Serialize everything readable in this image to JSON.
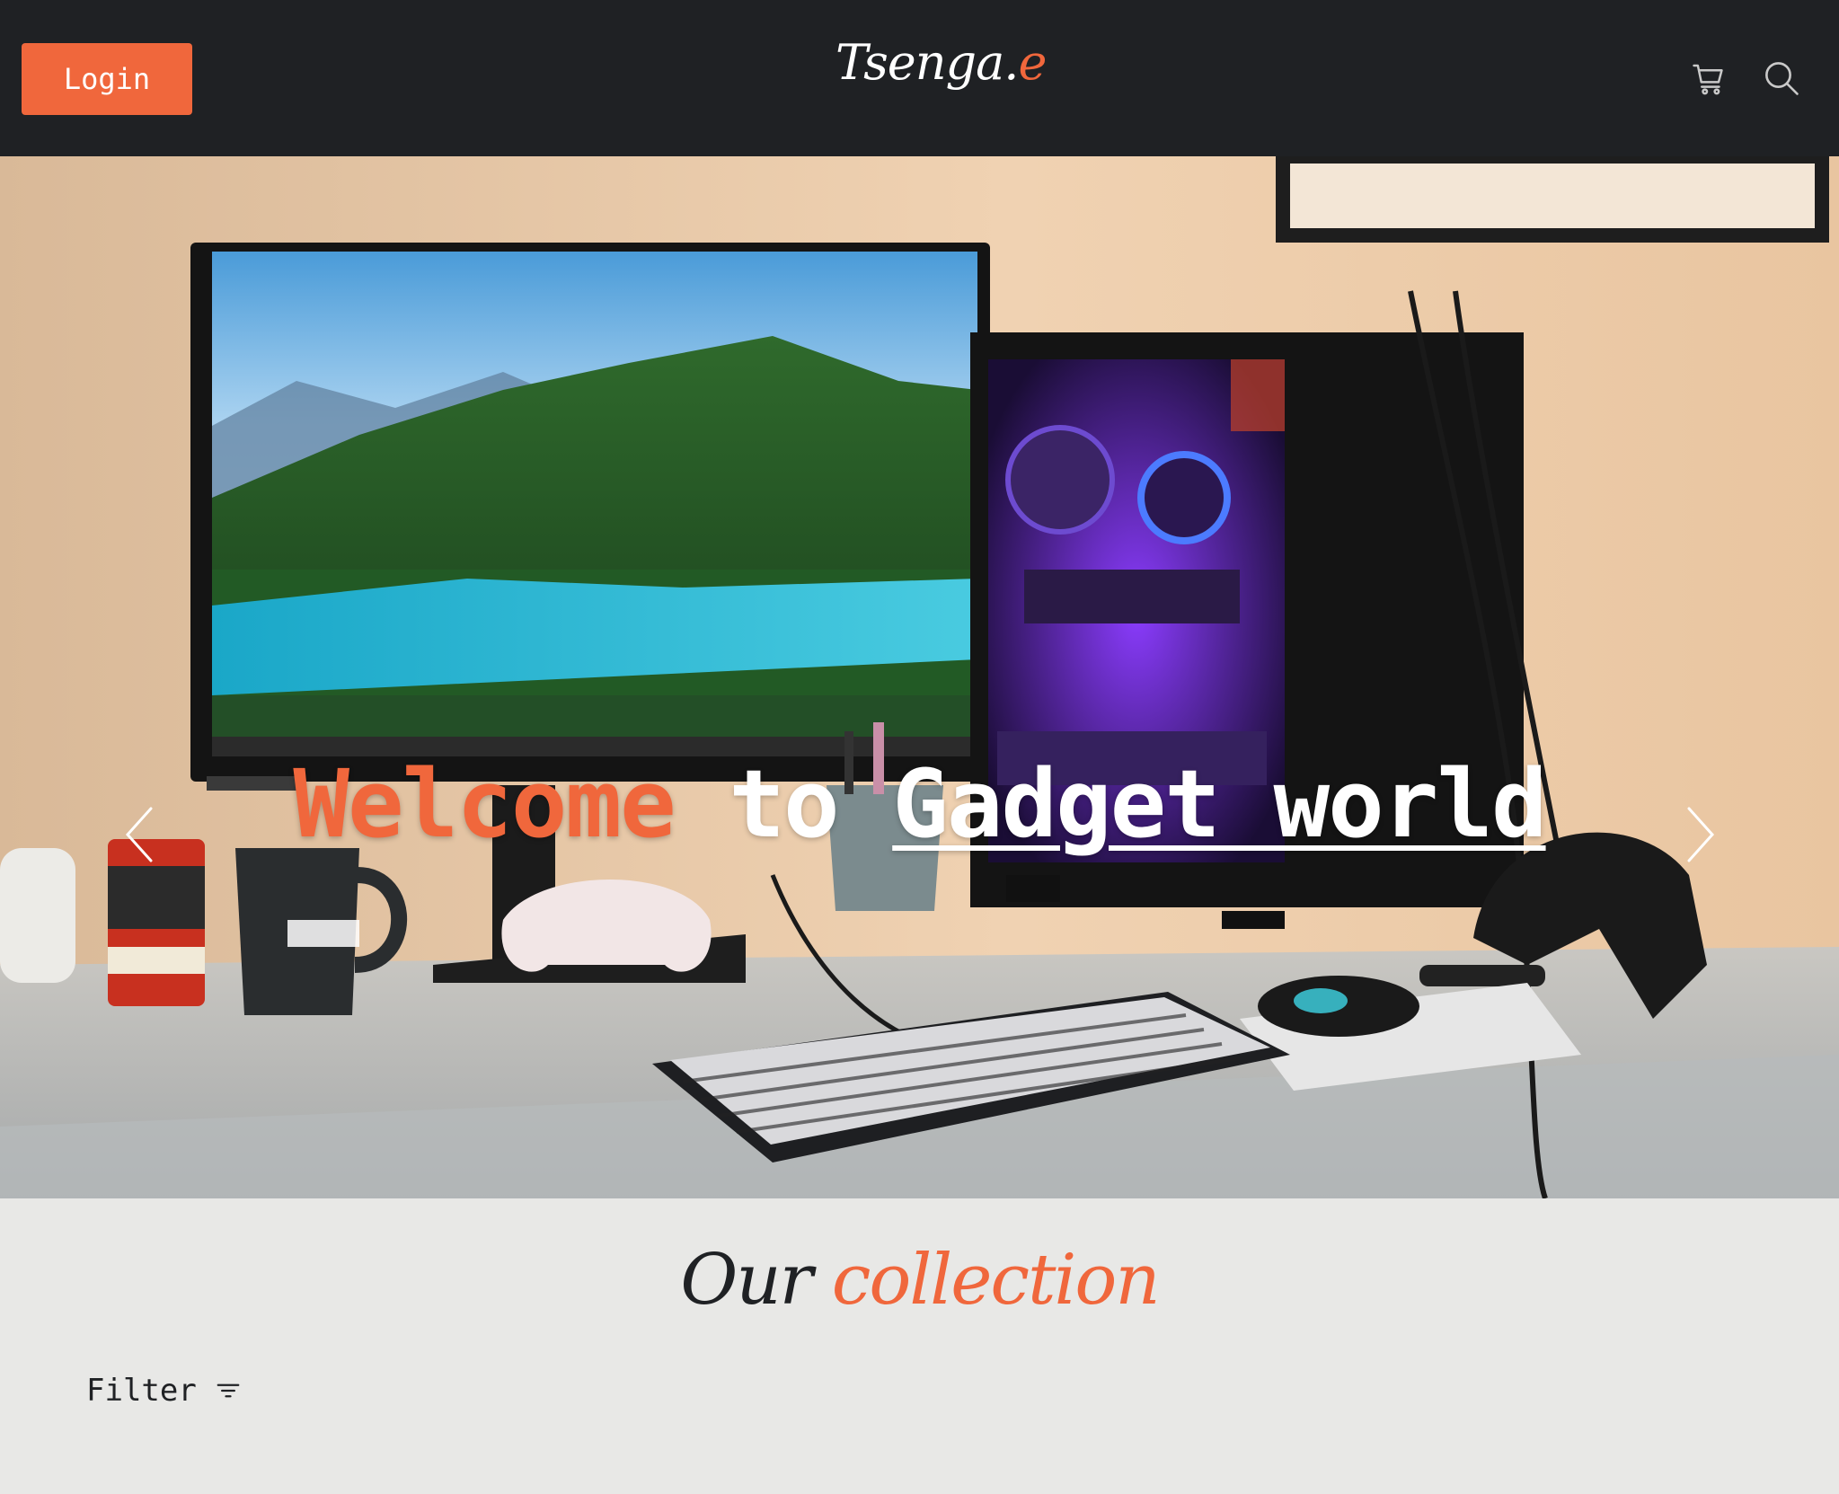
{
  "header": {
    "login_label": "Login",
    "logo_main": "Tsenga.",
    "logo_accent": "e",
    "icons": [
      "cart-icon",
      "search-icon"
    ]
  },
  "hero": {
    "title_welcome": "Welcome",
    "title_to": "to",
    "title_gadget": "Gadget world",
    "arrows": [
      "chevron-left-icon",
      "chevron-right-icon"
    ]
  },
  "collection": {
    "title_main": "Our",
    "title_accent": "collection",
    "filter_label": "Filter",
    "filter_icon": "filter-icon"
  },
  "colors": {
    "accent": "#f0673c",
    "navbar": "#1f2124",
    "page_background": "#e8e8e6"
  }
}
